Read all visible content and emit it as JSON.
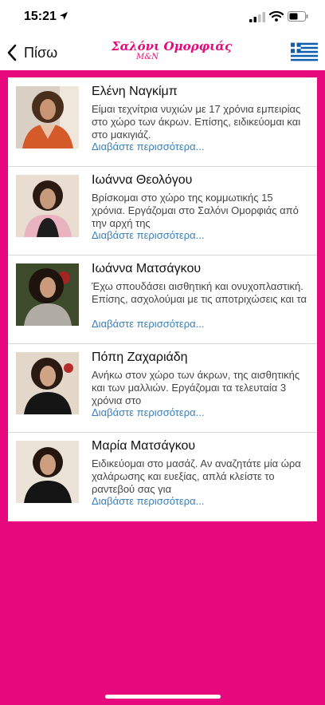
{
  "status_bar": {
    "time": "15:21"
  },
  "nav": {
    "back_label": "Πίσω",
    "logo_title": "Σαλόνι Ομορφιάς",
    "logo_subtitle": "M&N"
  },
  "staff": [
    {
      "name": "Ελένη Ναγκίμπ",
      "description": "Είμαι τεχνίτρια νυχιών με 17 χρόνια εμπειρίας στο χώρο των άκρων. Επίσης, ειδικεύομαι και στο μακιγιάζ.",
      "more": "Διαβάστε περισσότερα..."
    },
    {
      "name": "Ιωάννα Θεολόγου",
      "description": "Βρίσκομαι στο χώρο της κομμωτικής 15 χρόνια. Εργάζομαι στο Σαλόνι Ομορφιάς από την αρχή της",
      "more": "Διαβάστε περισσότερα..."
    },
    {
      "name": "Ιωάννα Ματσάγκου",
      "description": "Έχω σπουδάσει αισθητική και ονυχοπλαστική. Επίσης, ασχολούμαι με τις αποτριχώσεις και τα",
      "more": "Διαβάστε περισσότερα..."
    },
    {
      "name": "Πόπη Ζαχαριάδη",
      "description": "Ανήκω στον χώρο των άκρων, της αισθητικής και των μαλλιών. Εργάζομαι τα τελευταία 3 χρόνια στο",
      "more": "Διαβάστε περισσότερα..."
    },
    {
      "name": "Μαρία Ματσάγκου",
      "description": "Ειδικεύομαι στο μασάζ. Αν αναζητάτε μία ώρα χαλάρωσης και ευεξίας, απλά κλείστε το ραντεβού σας για",
      "more": "Διαβάστε περισσότερα..."
    }
  ],
  "colors": {
    "brand": "#e6087c",
    "link": "#3a7fb7"
  }
}
